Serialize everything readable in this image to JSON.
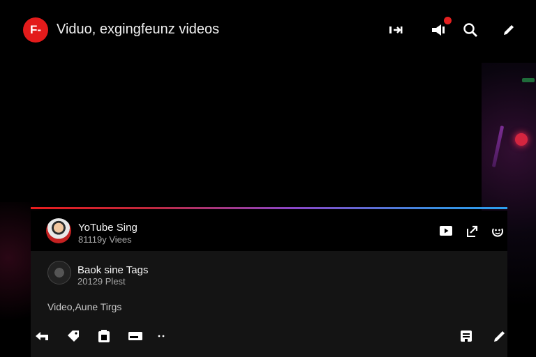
{
  "header": {
    "logo_text": "F-",
    "title": "Viduo, exgingfeunz videos",
    "notification_count": "",
    "icons": [
      "cast-icon",
      "notifications-icon",
      "search-icon",
      "edit-icon"
    ]
  },
  "progress_colors": [
    "#e81d1d",
    "#8a46c8",
    "#2c9ff0"
  ],
  "channel1": {
    "name": "YoTube Sing",
    "subtitle": "81119y Viees",
    "actions": [
      "play-icon",
      "share-icon",
      "face-icon"
    ]
  },
  "channel2": {
    "name": "Baok sine Tags",
    "subtitle": "20129 Plest"
  },
  "section": {
    "label": "Video,Aune Tirgs"
  },
  "toolbar": {
    "left_icons": [
      "back-icon",
      "tag-icon",
      "copy-icon",
      "card-icon",
      "more-icon"
    ],
    "right_icons": [
      "save-icon",
      "pen-icon"
    ]
  },
  "colors": {
    "background": "#000000",
    "panel": "#141414",
    "accent_red": "#e31b1b",
    "text": "#f1f1f1",
    "subtext": "#a9a9a9"
  }
}
